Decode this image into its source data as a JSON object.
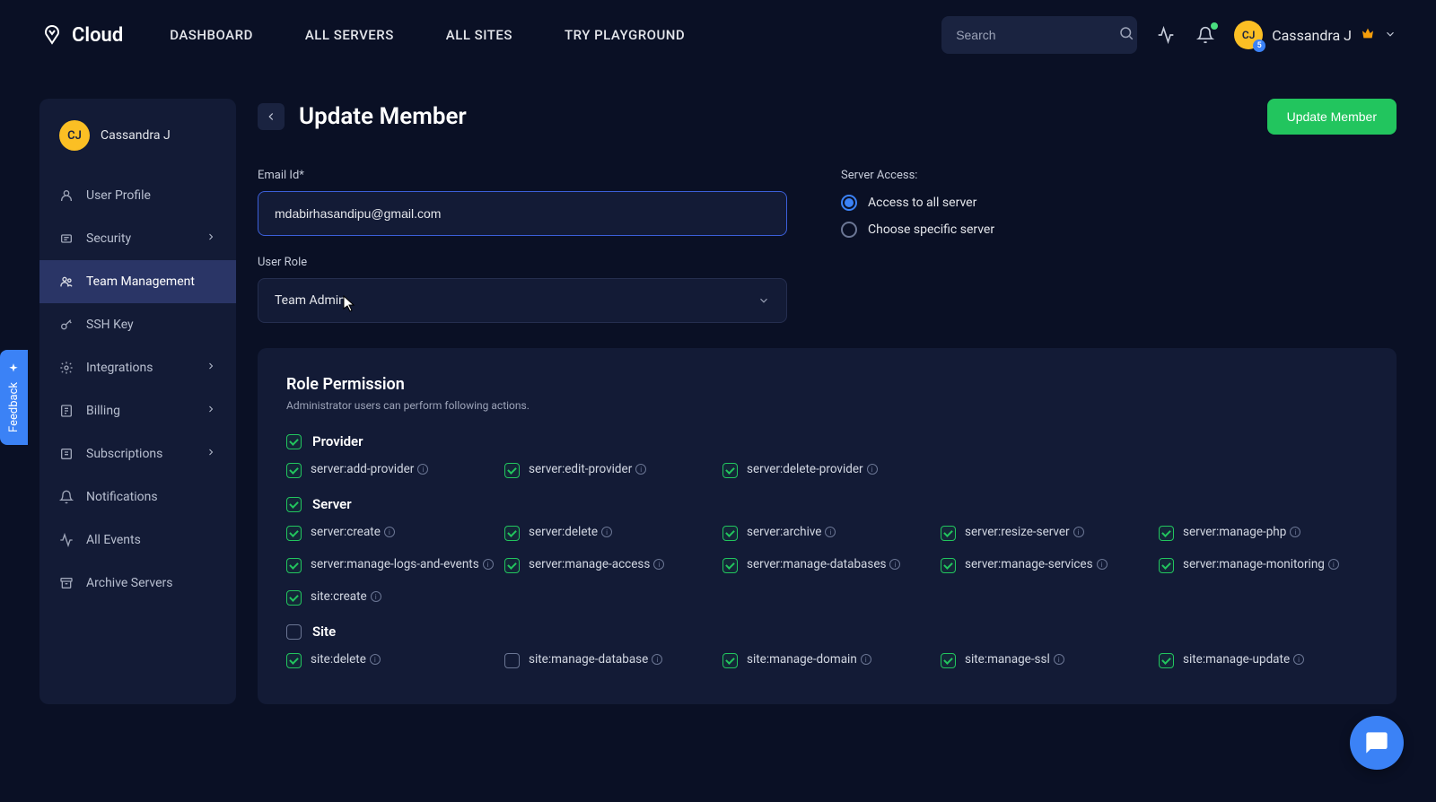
{
  "brand": "Cloud",
  "nav": [
    "DASHBOARD",
    "ALL SERVERS",
    "ALL SITES",
    "TRY PLAYGROUND"
  ],
  "search": {
    "placeholder": "Search"
  },
  "user": {
    "name": "Cassandra J",
    "initials": "CJ",
    "badge": "5"
  },
  "sidebar": {
    "user_name": "Cassandra J",
    "user_initials": "CJ",
    "items": [
      {
        "label": "User Profile",
        "icon": "user",
        "expandable": false
      },
      {
        "label": "Security",
        "icon": "shield",
        "expandable": true
      },
      {
        "label": "Team Management",
        "icon": "team",
        "expandable": false,
        "active": true
      },
      {
        "label": "SSH Key",
        "icon": "key",
        "expandable": false
      },
      {
        "label": "Integrations",
        "icon": "gear",
        "expandable": true
      },
      {
        "label": "Billing",
        "icon": "billing",
        "expandable": true
      },
      {
        "label": "Subscriptions",
        "icon": "sub",
        "expandable": true
      },
      {
        "label": "Notifications",
        "icon": "bell",
        "expandable": false
      },
      {
        "label": "All Events",
        "icon": "pulse",
        "expandable": false
      },
      {
        "label": "Archive Servers",
        "icon": "archive",
        "expandable": false
      }
    ]
  },
  "page": {
    "title": "Update Member",
    "action_label": "Update Member"
  },
  "form": {
    "email_label": "Email Id*",
    "email_value": "mdabirhasandipu@gmail.com",
    "role_label": "User Role",
    "role_value": "Team Admin",
    "server_access_label": "Server Access:",
    "access_options": [
      {
        "label": "Access to all server",
        "checked": true
      },
      {
        "label": "Choose specific server",
        "checked": false
      }
    ]
  },
  "permissions": {
    "title": "Role Permission",
    "subtitle": "Administrator users can perform following actions.",
    "groups": [
      {
        "name": "Provider",
        "group_checked": true,
        "items": [
          {
            "label": "server:add-provider",
            "checked": true
          },
          {
            "label": "server:edit-provider",
            "checked": true
          },
          {
            "label": "server:delete-provider",
            "checked": true
          }
        ]
      },
      {
        "name": "Server",
        "group_checked": true,
        "items": [
          {
            "label": "server:create",
            "checked": true
          },
          {
            "label": "server:delete",
            "checked": true
          },
          {
            "label": "server:archive",
            "checked": true
          },
          {
            "label": "server:resize-server",
            "checked": true
          },
          {
            "label": "server:manage-php",
            "checked": true
          },
          {
            "label": "server:manage-logs-and-events",
            "checked": true
          },
          {
            "label": "server:manage-access",
            "checked": true
          },
          {
            "label": "server:manage-databases",
            "checked": true
          },
          {
            "label": "server:manage-services",
            "checked": true
          },
          {
            "label": "server:manage-monitoring",
            "checked": true
          },
          {
            "label": "site:create",
            "checked": true
          }
        ]
      },
      {
        "name": "Site",
        "group_checked": false,
        "items": [
          {
            "label": "site:delete",
            "checked": true
          },
          {
            "label": "site:manage-database",
            "checked": false
          },
          {
            "label": "site:manage-domain",
            "checked": true
          },
          {
            "label": "site:manage-ssl",
            "checked": true
          },
          {
            "label": "site:manage-update",
            "checked": true
          }
        ]
      }
    ]
  },
  "feedback_label": "Feedback"
}
